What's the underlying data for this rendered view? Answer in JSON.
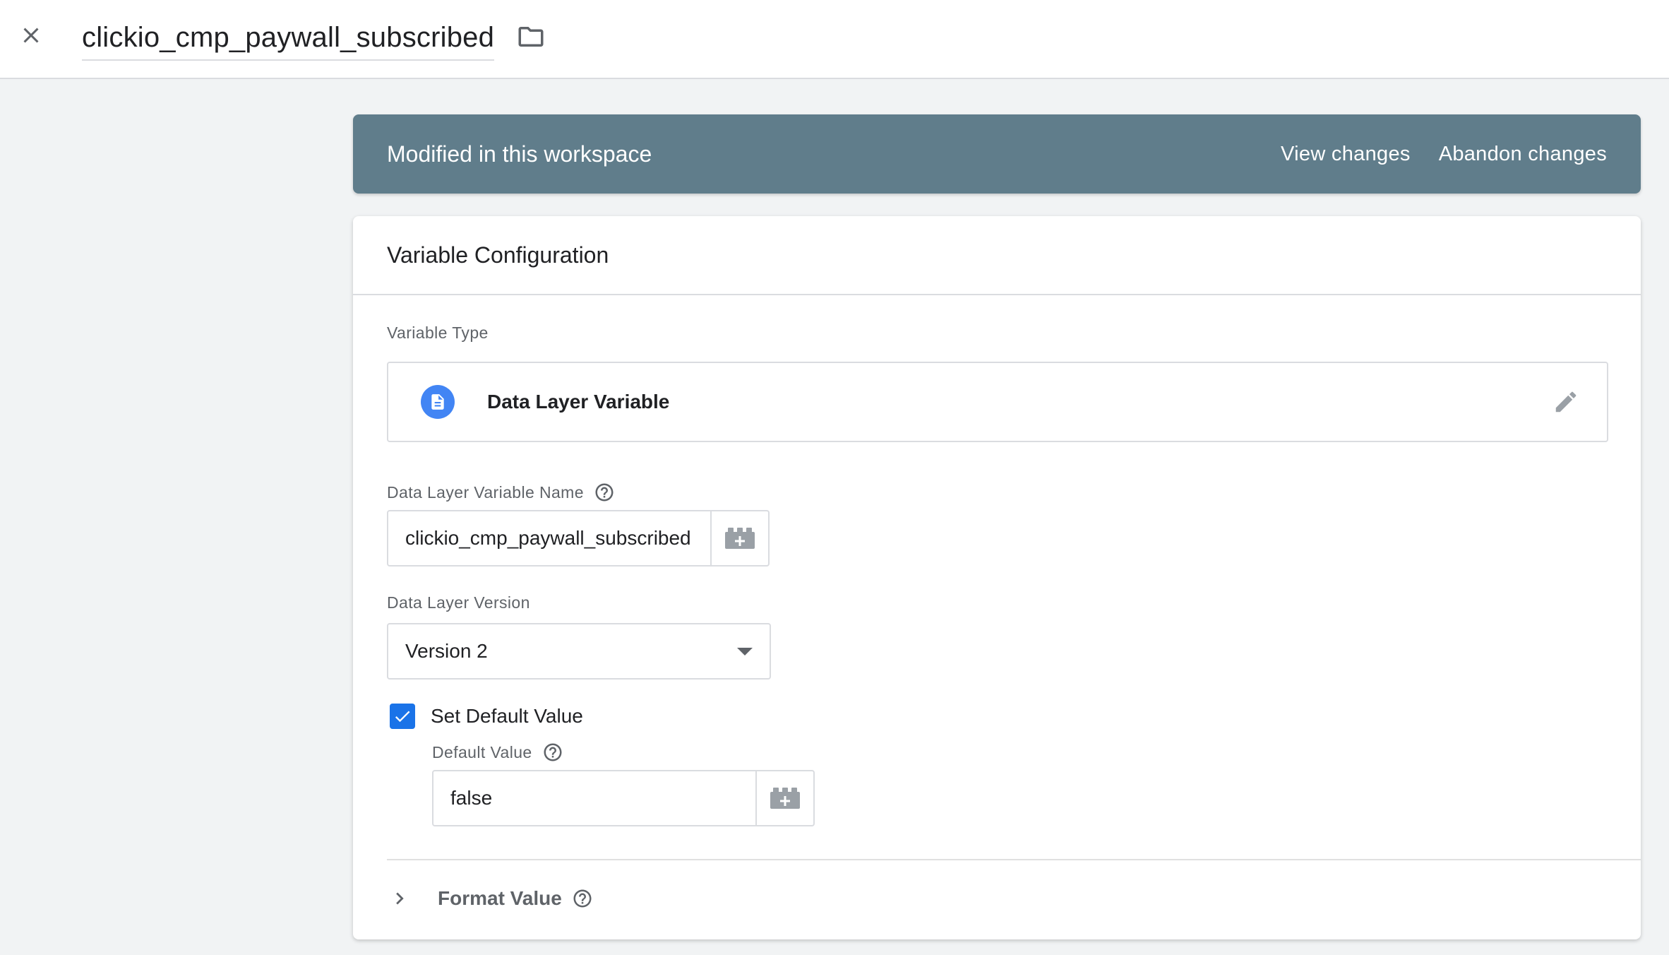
{
  "header": {
    "close_icon": "close-icon",
    "title": "clickio_cmp_paywall_subscribed",
    "folder_icon": "folder-icon"
  },
  "banner": {
    "text": "Modified in this workspace",
    "view_changes": "View changes",
    "abandon_changes": "Abandon changes",
    "background": "#607d8b"
  },
  "card": {
    "title": "Variable Configuration",
    "variable_type": {
      "label": "Variable Type",
      "value": "Data Layer Variable",
      "icon": "document-icon",
      "edit_icon": "pencil-icon",
      "icon_color": "#4285f4"
    },
    "dl_name": {
      "label": "Data Layer Variable Name",
      "value": "clickio_cmp_paywall_subscribed"
    },
    "dl_version": {
      "label": "Data Layer Version",
      "selected": "Version 2"
    },
    "default_value": {
      "checkbox_label": "Set Default Value",
      "checked": true,
      "label": "Default Value",
      "value": "false"
    },
    "format_value": {
      "label": "Format Value"
    }
  },
  "colors": {
    "accent": "#1a73e8",
    "page_bg": "#f1f3f4"
  }
}
